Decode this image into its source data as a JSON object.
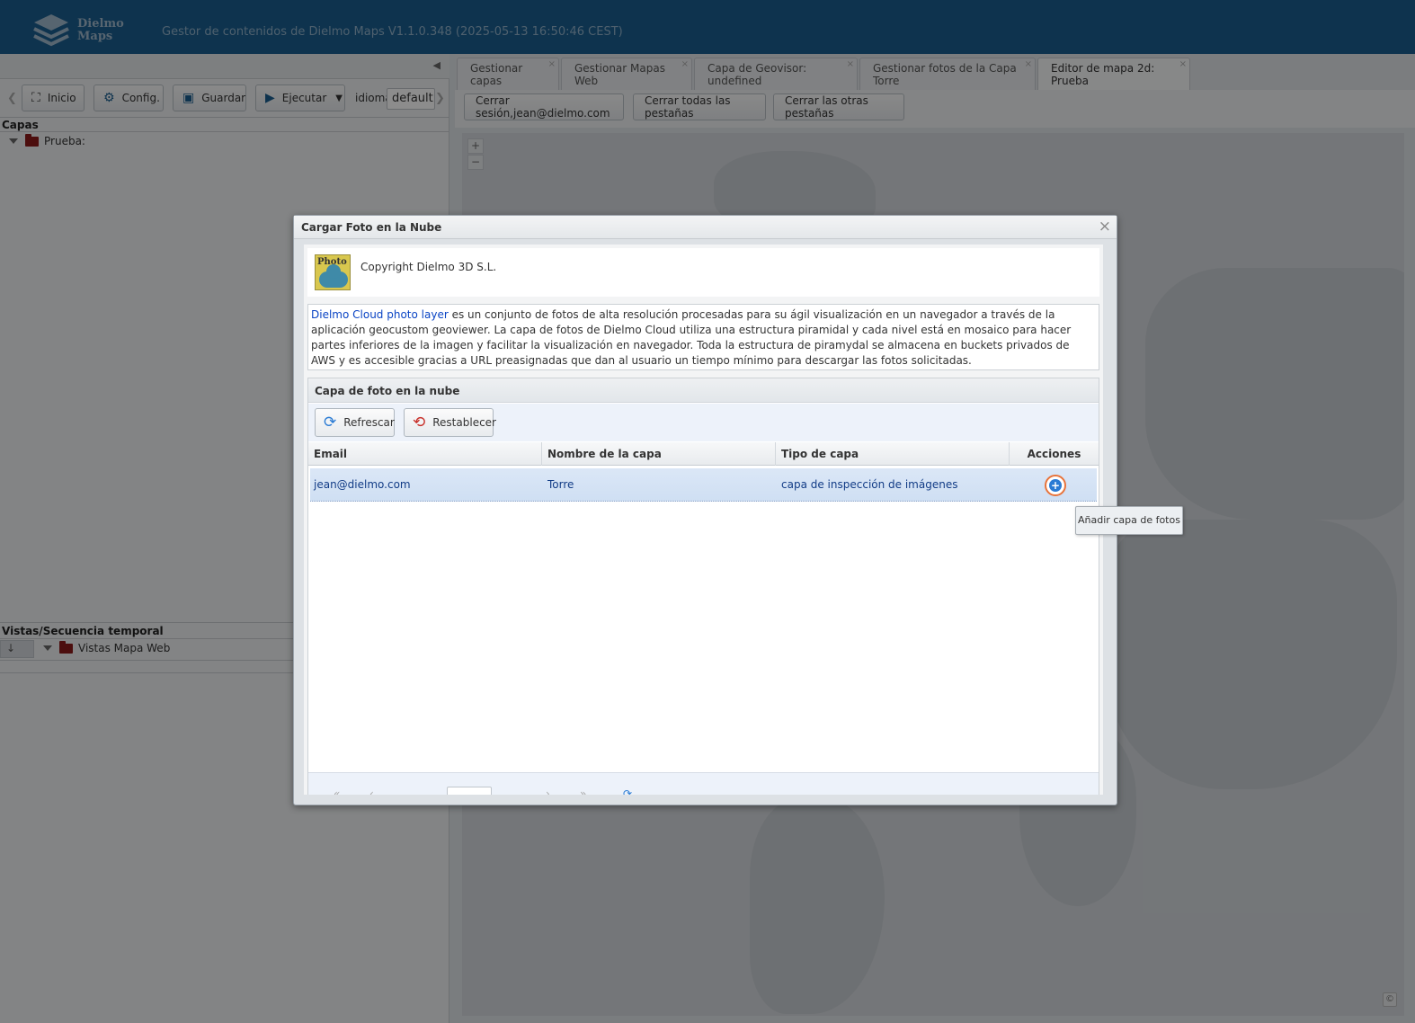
{
  "header": {
    "logo_line1": "Dielmo",
    "logo_line2": "Maps",
    "app_title": "Gestor de contenidos de Dielmo Maps V1.1.0.348 (2025-05-13 16:50:46 CEST)"
  },
  "left_panel": {
    "toolbar": {
      "inicio": "Inicio",
      "config": "Config.",
      "guardar": "Guardar",
      "ejecutar": "Ejecutar",
      "idioma_label": "idioma:",
      "idioma_value": "default"
    },
    "layers_title": "Capas",
    "layers_root": "Prueba:",
    "views_title": "Vistas/Secuencia temporal",
    "views_root": "Vistas Mapa Web"
  },
  "tabs": [
    {
      "label": "Gestionar capas"
    },
    {
      "label": "Gestionar Mapas Web"
    },
    {
      "label": "Capa de Geovisor: undefined"
    },
    {
      "label": "Gestionar fotos de la Capa Torre"
    },
    {
      "label": "Editor de mapa 2d: Prueba"
    }
  ],
  "session_buttons": {
    "logout": "Cerrar sesión,jean@dielmo.com",
    "close_all": "Cerrar todas las pestañas",
    "close_others": "Cerrar las otras pestañas"
  },
  "map": {
    "zoom_in": "+",
    "zoom_out": "−",
    "attribution": "©"
  },
  "modal": {
    "title": "Cargar Foto en la Nube",
    "close": "×",
    "logo_text": "Photo",
    "copyright": "Copyright Dielmo 3D S.L.",
    "description_link": "Dielmo Cloud photo layer",
    "description_rest": " es un conjunto de fotos de alta resolución procesadas para su ágil visualización en un navegador a través de la aplicación geocustom geoviewer. La capa de fotos de Dielmo Cloud utiliza una estructura piramidal y cada nivel está en mosaico para hacer partes inferiores de la imagen y facilitar la visualización en navegador. Toda la estructura de piramydal se almacena en buckets privados de AWS y es accesible gracias a URL preasignadas que dan al usuario un tiempo mínimo para descargar las fotos solicitadas.",
    "grid": {
      "title": "Capa de foto en la nube",
      "refresh_label": "Refrescar",
      "reset_label": "Restablecer",
      "columns": [
        "Email",
        "Nombre de la capa",
        "Tipo de capa",
        "Acciones"
      ],
      "rows": [
        {
          "email": "jean@dielmo.com",
          "name": "Torre",
          "type": "capa de inspección de imágenes"
        }
      ]
    }
  },
  "tooltip": "Añadir capa de fotos"
}
